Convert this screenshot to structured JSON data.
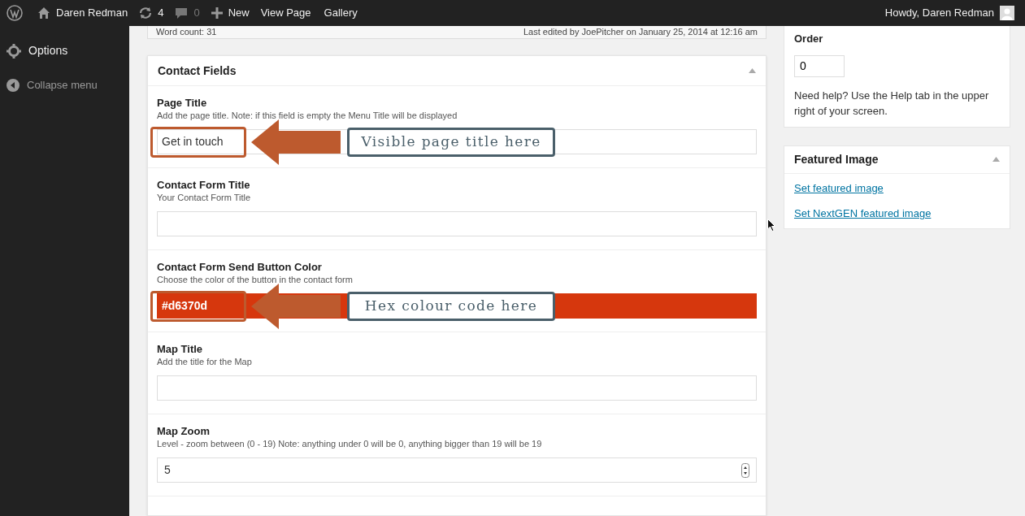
{
  "admin_bar": {
    "site": "Daren Redman",
    "updates": "4",
    "comments": "0",
    "new": "New",
    "links": [
      "View Page",
      "Gallery"
    ],
    "greeting": "Howdy, Daren Redman"
  },
  "sidebar": {
    "items": [
      {
        "label": "Options",
        "kind": "gear"
      },
      {
        "label": "Collapse menu",
        "kind": "collapse"
      }
    ]
  },
  "editor_footer": {
    "word_count": "Word count: 31",
    "last_edited": "Last edited by JoePitcher on January 25, 2014 at 12:16 am"
  },
  "contact_fields": {
    "title": "Contact Fields",
    "fields": [
      {
        "kind": "text",
        "label": "Page Title",
        "description": "Add the page title. Note: if this field is empty the Menu Title will be displayed",
        "value": "Get in touch",
        "annotation": "Visible page title here"
      },
      {
        "kind": "text",
        "label": "Contact Form Title",
        "description": "Your Contact Form Title"
      },
      {
        "kind": "color",
        "label": "Contact Form Send Button Color",
        "description": "Choose the color of the button in the contact form",
        "value": "#d6370d",
        "color": "#d6370d",
        "annotation": "Hex colour code here"
      },
      {
        "kind": "text",
        "label": "Map Title",
        "description": "Add the title for the Map"
      },
      {
        "kind": "number",
        "label": "Map Zoom",
        "description": "Level - zoom between (0 - 19) Note: anything under 0 will be 0, anything bigger than 19 will be 19",
        "value": "5"
      }
    ]
  },
  "order_box": {
    "label": "Order",
    "value": "0",
    "help": "Need help? Use the Help tab in the upper right of your screen."
  },
  "featured_image": {
    "title": "Featured Image",
    "links": [
      "Set featured image",
      "Set NextGEN featured image"
    ]
  }
}
